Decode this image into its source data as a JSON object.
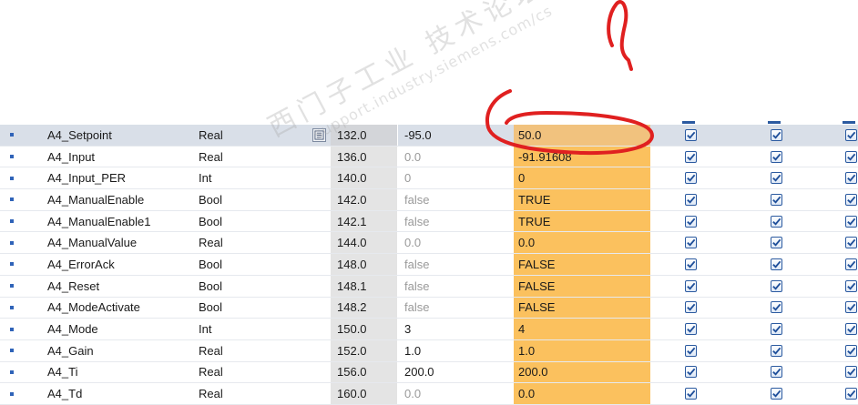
{
  "rows": [
    {
      "name": "A4_Setpoint",
      "type": "Real",
      "offset": "132.0",
      "start": "-95.0",
      "snapshot": "50.0",
      "start_muted": false,
      "selected": true
    },
    {
      "name": "A4_Input",
      "type": "Real",
      "offset": "136.0",
      "start": "0.0",
      "snapshot": "-91.91608",
      "start_muted": true,
      "selected": false
    },
    {
      "name": "A4_Input_PER",
      "type": "Int",
      "offset": "140.0",
      "start": "0",
      "snapshot": "0",
      "start_muted": true,
      "selected": false
    },
    {
      "name": "A4_ManualEnable",
      "type": "Bool",
      "offset": "142.0",
      "start": "false",
      "snapshot": "TRUE",
      "start_muted": true,
      "selected": false
    },
    {
      "name": "A4_ManualEnable1",
      "type": "Bool",
      "offset": "142.1",
      "start": "false",
      "snapshot": "TRUE",
      "start_muted": true,
      "selected": false
    },
    {
      "name": "A4_ManualValue",
      "type": "Real",
      "offset": "144.0",
      "start": "0.0",
      "snapshot": "0.0",
      "start_muted": true,
      "selected": false
    },
    {
      "name": "A4_ErrorAck",
      "type": "Bool",
      "offset": "148.0",
      "start": "false",
      "snapshot": "FALSE",
      "start_muted": true,
      "selected": false
    },
    {
      "name": "A4_Reset",
      "type": "Bool",
      "offset": "148.1",
      "start": "false",
      "snapshot": "FALSE",
      "start_muted": true,
      "selected": false
    },
    {
      "name": "A4_ModeActivate",
      "type": "Bool",
      "offset": "148.2",
      "start": "false",
      "snapshot": "FALSE",
      "start_muted": true,
      "selected": false
    },
    {
      "name": "A4_Mode",
      "type": "Int",
      "offset": "150.0",
      "start": "3",
      "snapshot": "4",
      "start_muted": false,
      "selected": false
    },
    {
      "name": "A4_Gain",
      "type": "Real",
      "offset": "152.0",
      "start": "1.0",
      "snapshot": "1.0",
      "start_muted": false,
      "selected": false
    },
    {
      "name": "A4_Ti",
      "type": "Real",
      "offset": "156.0",
      "start": "200.0",
      "snapshot": "200.0",
      "start_muted": false,
      "selected": false
    },
    {
      "name": "A4_Td",
      "type": "Real",
      "offset": "160.0",
      "start": "0.0",
      "snapshot": "0.0",
      "start_muted": true,
      "selected": false
    }
  ],
  "checkbox_columns": 3,
  "checkbox_checked": true,
  "icons": {
    "row_marker": "bullet-icon",
    "browse": "browse-list-icon",
    "checkbox": "checkbox-checked-icon"
  },
  "colors": {
    "snapshot_highlight": "#fbc15e",
    "offset_column": "#e4e4e4",
    "selected_row": "#d9dfe8",
    "annotation": "#e02020",
    "checkbox_border": "#2b5aa0"
  },
  "watermark": {
    "main": "西门子工业 技术论坛",
    "sub": "support.industry.siemens.com/cs"
  }
}
